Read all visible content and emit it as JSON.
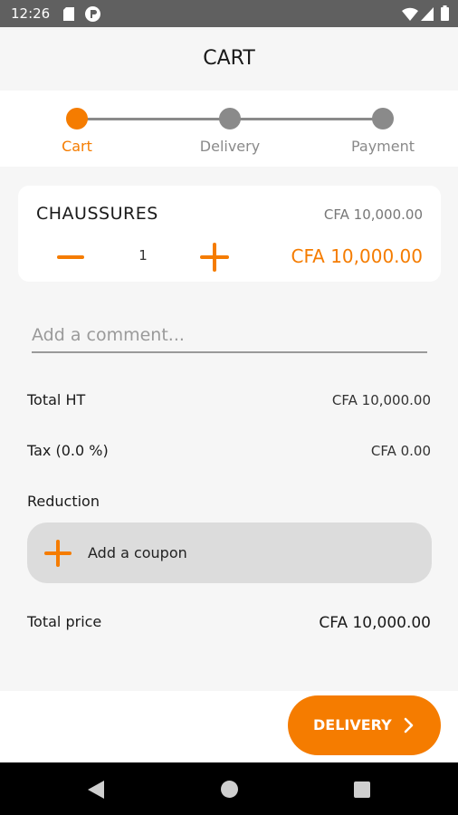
{
  "status_bar": {
    "time": "12:26",
    "icons": [
      "sd-card-icon",
      "app-notification-icon",
      "wifi-icon",
      "signal-icon",
      "battery-icon"
    ]
  },
  "app_bar": {
    "title": "CART"
  },
  "stepper": {
    "steps": [
      {
        "label": "Cart",
        "active": true
      },
      {
        "label": "Delivery",
        "active": false
      },
      {
        "label": "Payment",
        "active": false
      }
    ],
    "active_color": "#f57c00",
    "inactive_color": "#8a8a8a"
  },
  "cart_item": {
    "name": "CHAUSSURES",
    "unit_price": "CFA 10,000.00",
    "quantity": "1",
    "total": "CFA 10,000.00"
  },
  "comment": {
    "placeholder": "Add a comment...",
    "value": ""
  },
  "summary": {
    "total_ht_label": "Total HT",
    "total_ht_value": "CFA 10,000.00",
    "tax_label": "Tax (0.0 %)",
    "tax_value": "CFA 0.00",
    "reduction_label": "Reduction",
    "coupon_label": "Add a coupon",
    "total_price_label": "Total price",
    "total_price_value": "CFA 10,000.00"
  },
  "footer": {
    "delivery_button": "DELIVERY"
  },
  "colors": {
    "accent": "#f57c00",
    "status_bar": "#606060",
    "coupon_bg": "#dcdcdc"
  }
}
